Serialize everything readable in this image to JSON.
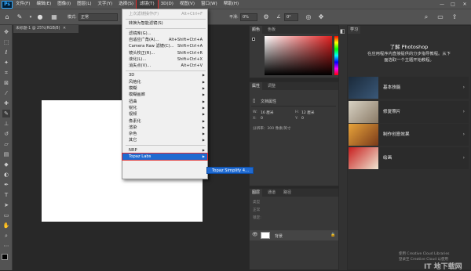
{
  "app": {
    "logo": "Ps"
  },
  "menubar": {
    "items": [
      "文件(F)",
      "编辑(E)",
      "图像(I)",
      "图层(L)",
      "文字(Y)",
      "选择(S)",
      "滤镜(T)",
      "3D(D)",
      "视图(V)",
      "窗口(W)",
      "帮助(H)"
    ],
    "window_controls": [
      "—",
      "□",
      "✕"
    ]
  },
  "options_bar": {
    "mode_label": "模式:",
    "mode_value": "正常",
    "flow_label": "平滑:",
    "flow_value": "0%",
    "angle_value": "0°"
  },
  "document": {
    "tab_title": "未标题-1 @ 25%(RGB/8)",
    "close": "✕"
  },
  "filter_menu": {
    "items": [
      {
        "label": "上次滤镜操作(F)",
        "shortcut": "Alt+Ctrl+F",
        "disabled": true
      },
      {
        "sep": true
      },
      {
        "label": "转换为智能滤镜(S)"
      },
      {
        "sep": true
      },
      {
        "label": "滤镜库(G)..."
      },
      {
        "label": "自适应广角(A)...",
        "shortcut": "Alt+Shift+Ctrl+A"
      },
      {
        "label": "Camera Raw 滤镜(C)...",
        "shortcut": "Shift+Ctrl+A"
      },
      {
        "label": "镜头校正(R)...",
        "shortcut": "Shift+Ctrl+R"
      },
      {
        "label": "液化(L)...",
        "shortcut": "Shift+Ctrl+X"
      },
      {
        "label": "消失点(V)...",
        "shortcut": "Alt+Ctrl+V"
      },
      {
        "sep": true
      },
      {
        "label": "3D",
        "sub": true
      },
      {
        "label": "风格化",
        "sub": true
      },
      {
        "label": "模糊",
        "sub": true
      },
      {
        "label": "模糊画廊",
        "sub": true
      },
      {
        "label": "扭曲",
        "sub": true
      },
      {
        "label": "锐化",
        "sub": true
      },
      {
        "label": "视频",
        "sub": true
      },
      {
        "label": "像素化",
        "sub": true
      },
      {
        "label": "渲染",
        "sub": true
      },
      {
        "label": "杂色",
        "sub": true
      },
      {
        "label": "其它",
        "sub": true
      },
      {
        "sep": true
      },
      {
        "label": "NRP",
        "sub": true
      },
      {
        "label": "Topaz Labs",
        "sub": true,
        "highlight": true
      }
    ],
    "submenu_item": "Topaz Simplify 4..."
  },
  "color_panel": {
    "tabs": [
      "颜色",
      "色板"
    ]
  },
  "properties_panel": {
    "tabs": [
      "属性",
      "调整"
    ],
    "doc_label": "文档属性",
    "w_label": "W:",
    "w_value": "16 厘米",
    "h_label": "H:",
    "h_value": "12 厘米",
    "x_label": "X:",
    "x_value": "0",
    "y_label": "Y:",
    "y_value": "0",
    "resolution": "分辨率：300 像素/英寸"
  },
  "layers_panel": {
    "tabs": [
      "图层",
      "通道",
      "路径"
    ],
    "kind_label": "类型",
    "blend_value": "正常",
    "lock_label": "锁定:",
    "layer_name": "背景"
  },
  "learn_panel": {
    "tab": "学习",
    "title": "了解 Photoshop",
    "description_line1": "在应用程序内直接提供的分步指导教程。从下",
    "description_line2": "面选取一个主题开始教程。",
    "cards": [
      "基本技能",
      "修复照片",
      "制作创意效果",
      "绘画"
    ],
    "footer_line1": "使用 Creative Cloud Libraries",
    "footer_line2": "登录至 Creative Cloud 以使用",
    "watermark": "IT 地下载网"
  },
  "colors": {
    "menu_bg": "#535353",
    "highlight_blue": "#1f6ad1",
    "callout_red": "#e12d2d"
  }
}
